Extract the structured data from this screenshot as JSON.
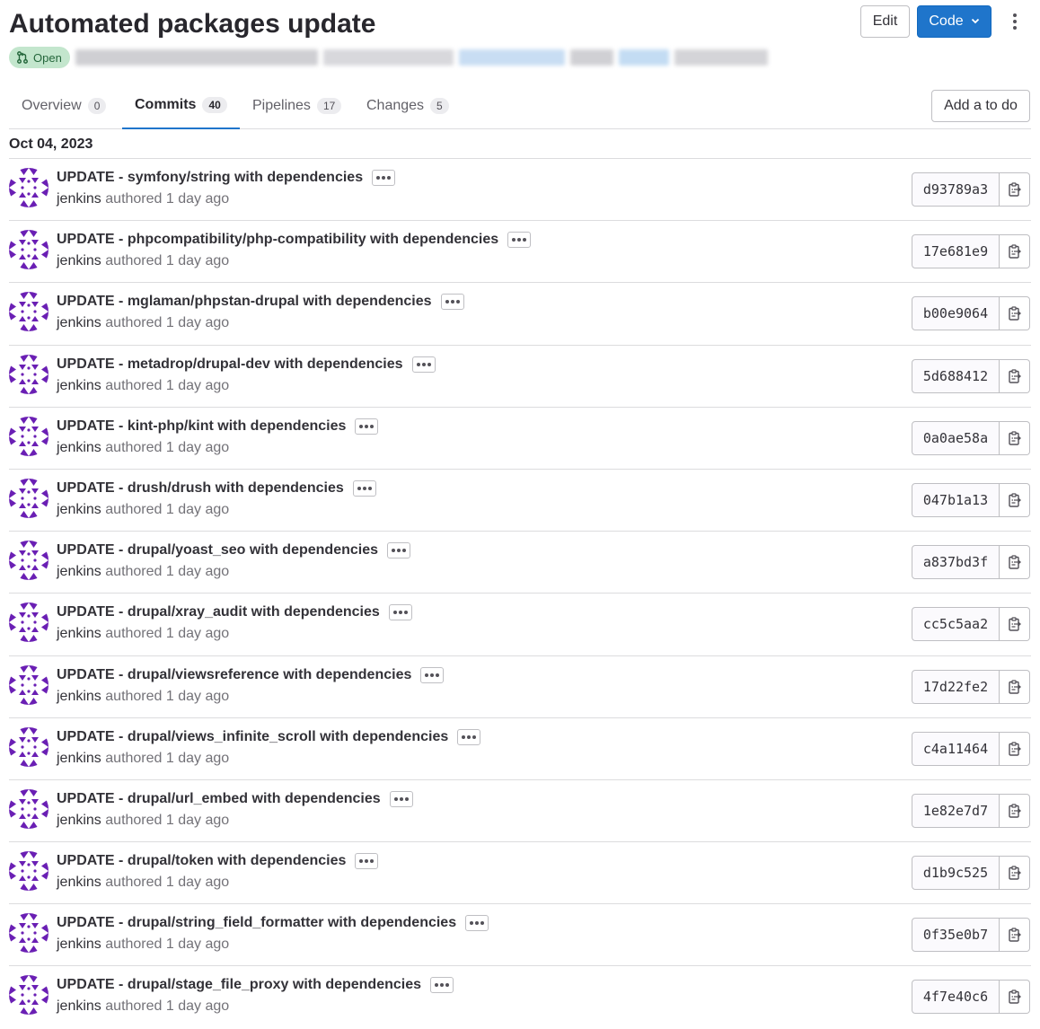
{
  "header": {
    "title": "Automated packages update",
    "status_label": "Open",
    "edit_label": "Edit",
    "code_label": "Code"
  },
  "tabs": [
    {
      "label": "Overview",
      "count": "0"
    },
    {
      "label": "Commits",
      "count": "40"
    },
    {
      "label": "Pipelines",
      "count": "17"
    },
    {
      "label": "Changes",
      "count": "5"
    }
  ],
  "todo_label": "Add a to do",
  "date": "Oct 04, 2023",
  "commits": [
    {
      "message": "UPDATE - symfony/string with dependencies",
      "author": "jenkins",
      "authored": "authored",
      "time": "1 day ago",
      "sha": "d93789a3"
    },
    {
      "message": "UPDATE - phpcompatibility/php-compatibility with dependencies",
      "author": "jenkins",
      "authored": "authored",
      "time": "1 day ago",
      "sha": "17e681e9"
    },
    {
      "message": "UPDATE - mglaman/phpstan-drupal with dependencies",
      "author": "jenkins",
      "authored": "authored",
      "time": "1 day ago",
      "sha": "b00e9064"
    },
    {
      "message": "UPDATE - metadrop/drupal-dev with dependencies",
      "author": "jenkins",
      "authored": "authored",
      "time": "1 day ago",
      "sha": "5d688412"
    },
    {
      "message": "UPDATE - kint-php/kint with dependencies",
      "author": "jenkins",
      "authored": "authored",
      "time": "1 day ago",
      "sha": "0a0ae58a"
    },
    {
      "message": "UPDATE - drush/drush with dependencies",
      "author": "jenkins",
      "authored": "authored",
      "time": "1 day ago",
      "sha": "047b1a13"
    },
    {
      "message": "UPDATE - drupal/yoast_seo with dependencies",
      "author": "jenkins",
      "authored": "authored",
      "time": "1 day ago",
      "sha": "a837bd3f"
    },
    {
      "message": "UPDATE - drupal/xray_audit with dependencies",
      "author": "jenkins",
      "authored": "authored",
      "time": "1 day ago",
      "sha": "cc5c5aa2"
    },
    {
      "message": "UPDATE - drupal/viewsreference with dependencies",
      "author": "jenkins",
      "authored": "authored",
      "time": "1 day ago",
      "sha": "17d22fe2"
    },
    {
      "message": "UPDATE - drupal/views_infinite_scroll with dependencies",
      "author": "jenkins",
      "authored": "authored",
      "time": "1 day ago",
      "sha": "c4a11464"
    },
    {
      "message": "UPDATE - drupal/url_embed with dependencies",
      "author": "jenkins",
      "authored": "authored",
      "time": "1 day ago",
      "sha": "1e82e7d7"
    },
    {
      "message": "UPDATE - drupal/token with dependencies",
      "author": "jenkins",
      "authored": "authored",
      "time": "1 day ago",
      "sha": "d1b9c525"
    },
    {
      "message": "UPDATE - drupal/string_field_formatter with dependencies",
      "author": "jenkins",
      "authored": "authored",
      "time": "1 day ago",
      "sha": "0f35e0b7"
    },
    {
      "message": "UPDATE - drupal/stage_file_proxy with dependencies",
      "author": "jenkins",
      "authored": "authored",
      "time": "1 day ago",
      "sha": "4f7e40c6"
    }
  ],
  "colors": {
    "accent": "#1f75cb",
    "avatar": "#6a1fb4",
    "open_badge_bg": "#c3e6cd",
    "open_badge_text": "#24663b"
  },
  "icons": {
    "status": "merge-request-icon",
    "code_caret": "chevron-down-icon",
    "more": "kebab-icon",
    "row_toggle": "ellipsis-icon",
    "copy": "copy-to-clipboard-icon"
  }
}
